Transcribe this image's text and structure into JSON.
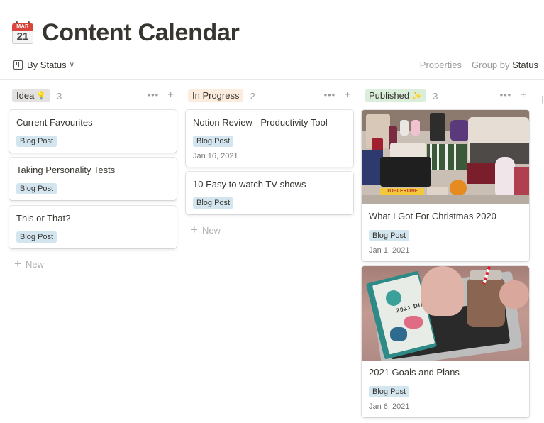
{
  "page": {
    "icon_month": "MAR",
    "icon_day": "21",
    "title": "Content Calendar"
  },
  "view": {
    "label": "By Status",
    "properties_label": "Properties",
    "group_by_label": "Group by",
    "group_by_value": "Status"
  },
  "colors": {
    "idea": "#e3e2e0",
    "in_progress": "#fbecdd",
    "published": "#dbeddb",
    "tag_blue": "#d3e5ef"
  },
  "columns": [
    {
      "name": "Idea",
      "emoji": "💡",
      "count": "3",
      "cards": [
        {
          "title": "Current Favourites",
          "tag": "Blog Post"
        },
        {
          "title": "Taking Personality Tests",
          "tag": "Blog Post"
        },
        {
          "title": "This or That?",
          "tag": "Blog Post"
        }
      ],
      "new_label": "New"
    },
    {
      "name": "In Progress",
      "emoji": "",
      "count": "2",
      "cards": [
        {
          "title": "Notion Review - Productivity Tool",
          "tag": "Blog Post",
          "date": "Jan 16, 2021"
        },
        {
          "title": "10 Easy to watch TV shows",
          "tag": "Blog Post"
        }
      ],
      "new_label": "New"
    },
    {
      "name": "Published",
      "emoji": "✨",
      "count": "3",
      "cards": [
        {
          "title": "What I Got For Christmas 2020",
          "tag": "Blog Post",
          "date": "Jan 1, 2021",
          "cover_label": "TOBLERONE"
        },
        {
          "title": "2021 Goals and Plans",
          "tag": "Blog Post",
          "date": "Jan 6, 2021",
          "cover_label": "2021 DIARY"
        }
      ]
    }
  ],
  "icons": [
    "calendar-icon",
    "board-view-icon",
    "chevron-down-icon",
    "more-icon",
    "plus-icon",
    "lightbulb-icon",
    "sparkles-icon"
  ]
}
